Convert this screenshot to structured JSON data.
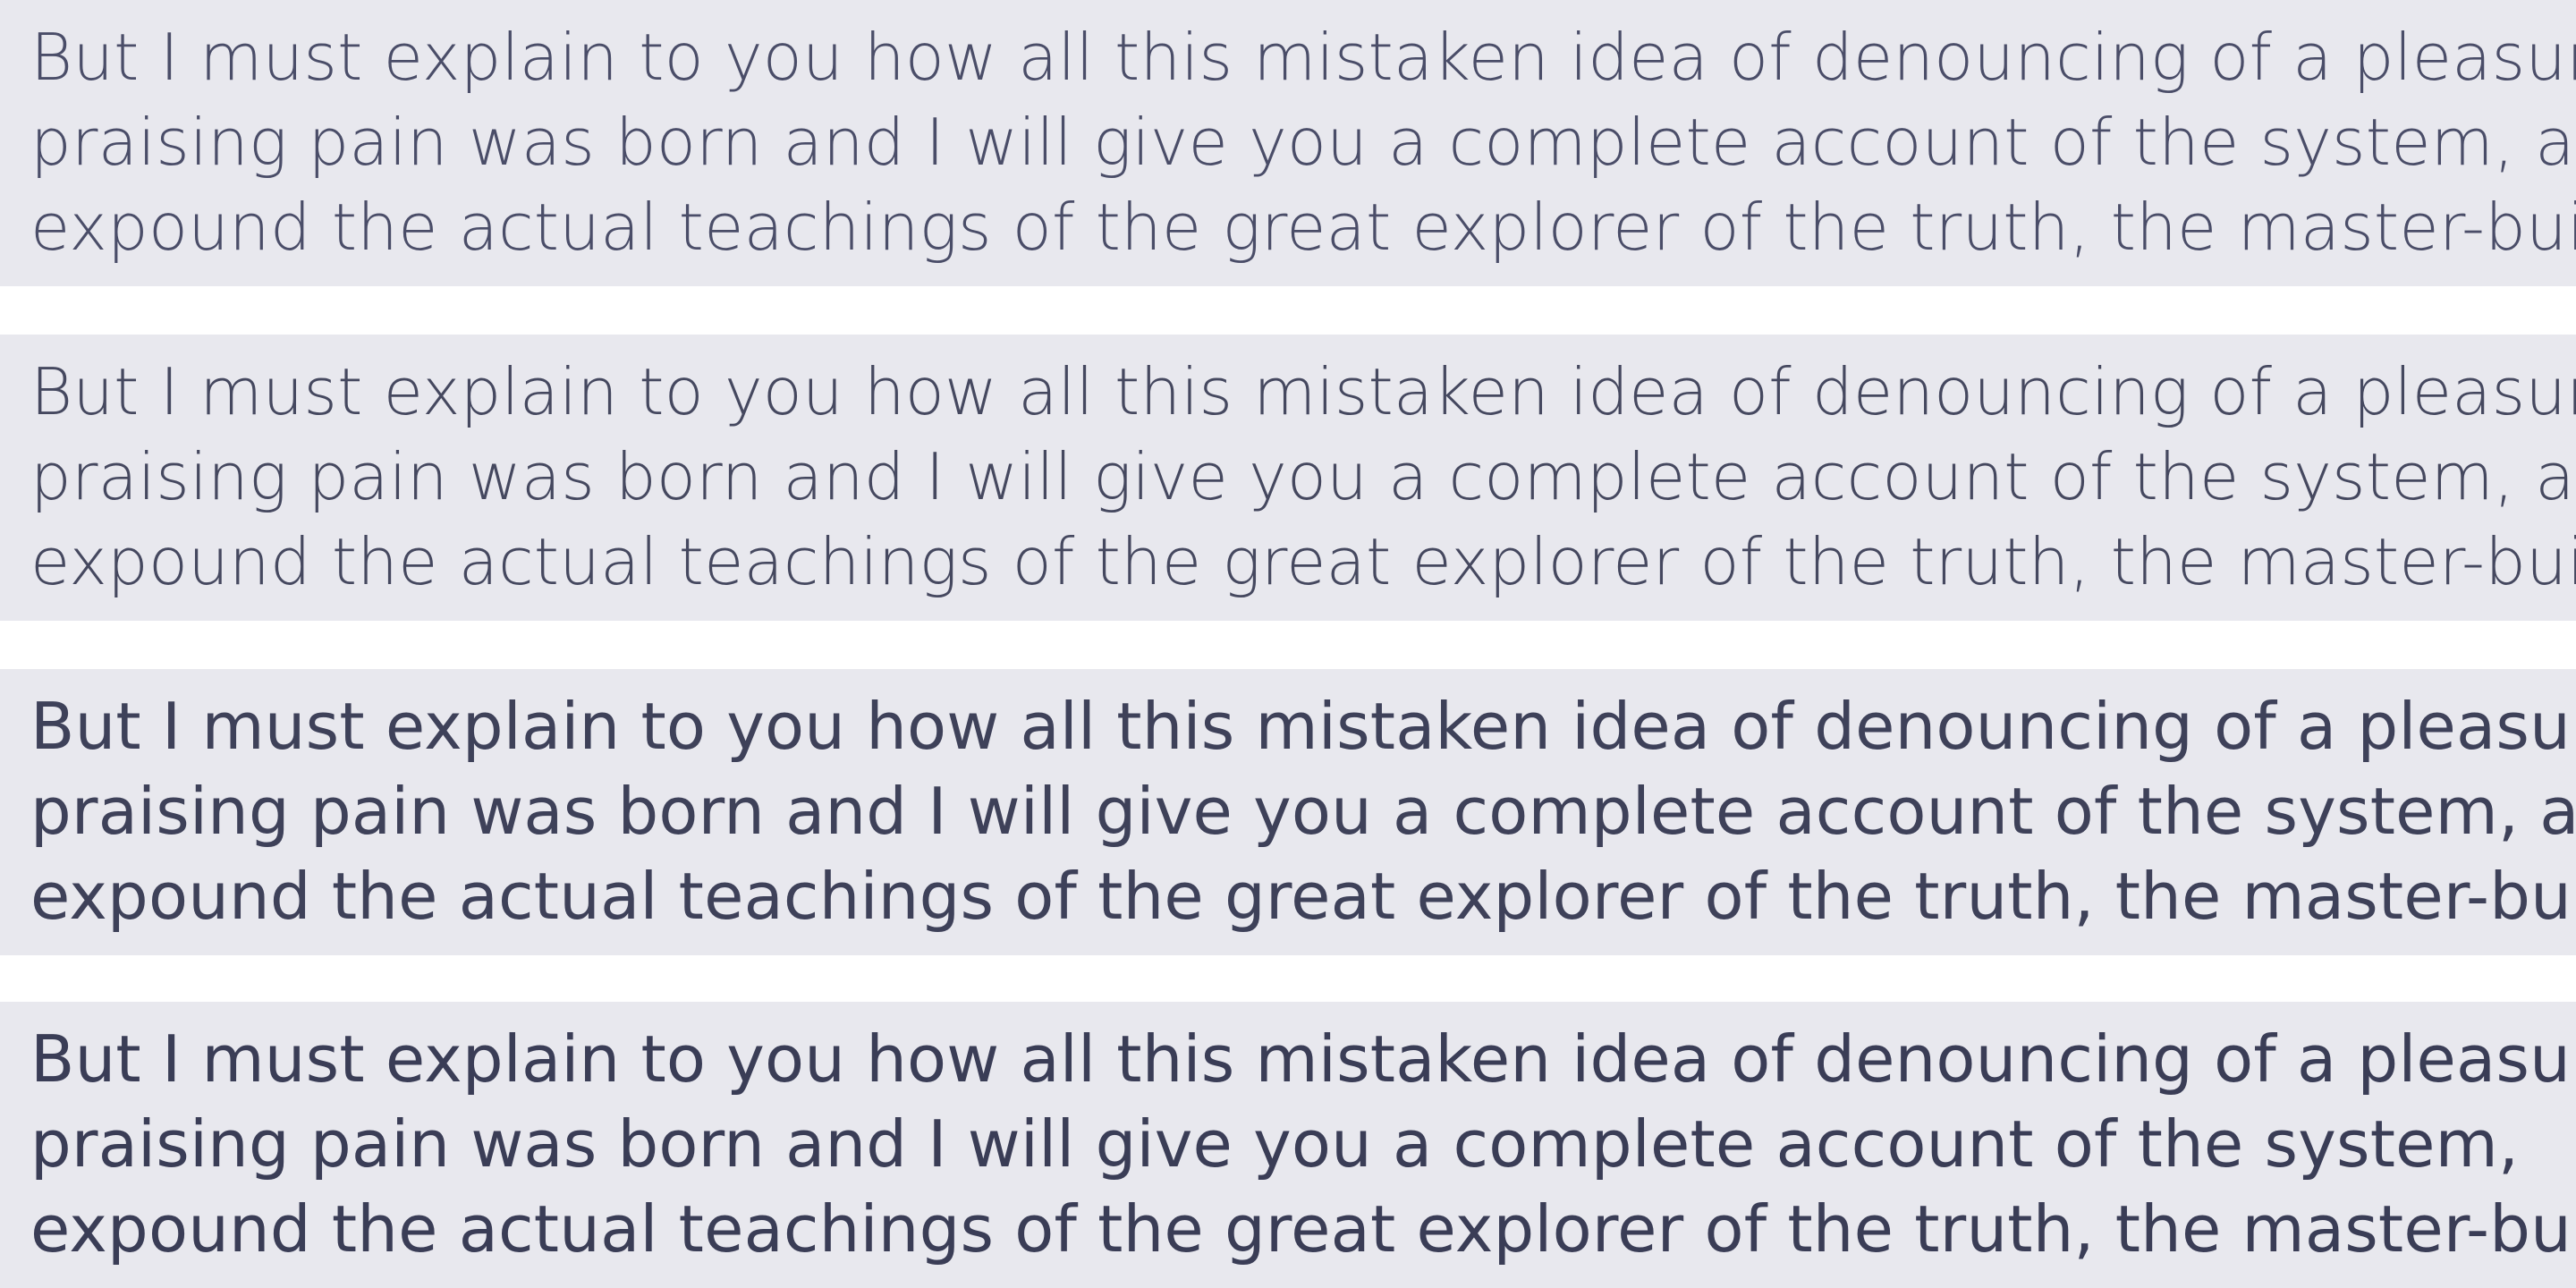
{
  "samples": [
    {
      "lines": [
        "But I must explain to you how all this mistaken idea of denouncing of a pleasure a",
        "praising pain was born and I will give you a complete account of the system, and",
        "expound the actual teachings of the great explorer of the truth, the master-builde"
      ]
    },
    {
      "lines": [
        "But I must explain to you how all this mistaken idea of denouncing of a pleasure",
        "praising pain was born and I will give you a complete account of the system, an",
        "expound the actual teachings of the great explorer of the truth, the master-build"
      ]
    },
    {
      "lines": [
        "But I must explain to you how all this mistaken idea of denouncing of a pleasu",
        "praising pain was born and I will give you a complete account of the system, a",
        "expound the actual teachings of the great explorer of the truth, the master-bui"
      ]
    },
    {
      "lines": [
        "But I must explain to you how all this mistaken idea of denouncing of a pleasu",
        "praising pain was born and I will give you a complete account of the system,",
        "expound the actual teachings of the great explorer of the truth, the master-bu"
      ]
    }
  ],
  "colors": {
    "panel_background": "#e8e8ee",
    "page_background": "#ffffff",
    "text": "#3c3f5a"
  }
}
